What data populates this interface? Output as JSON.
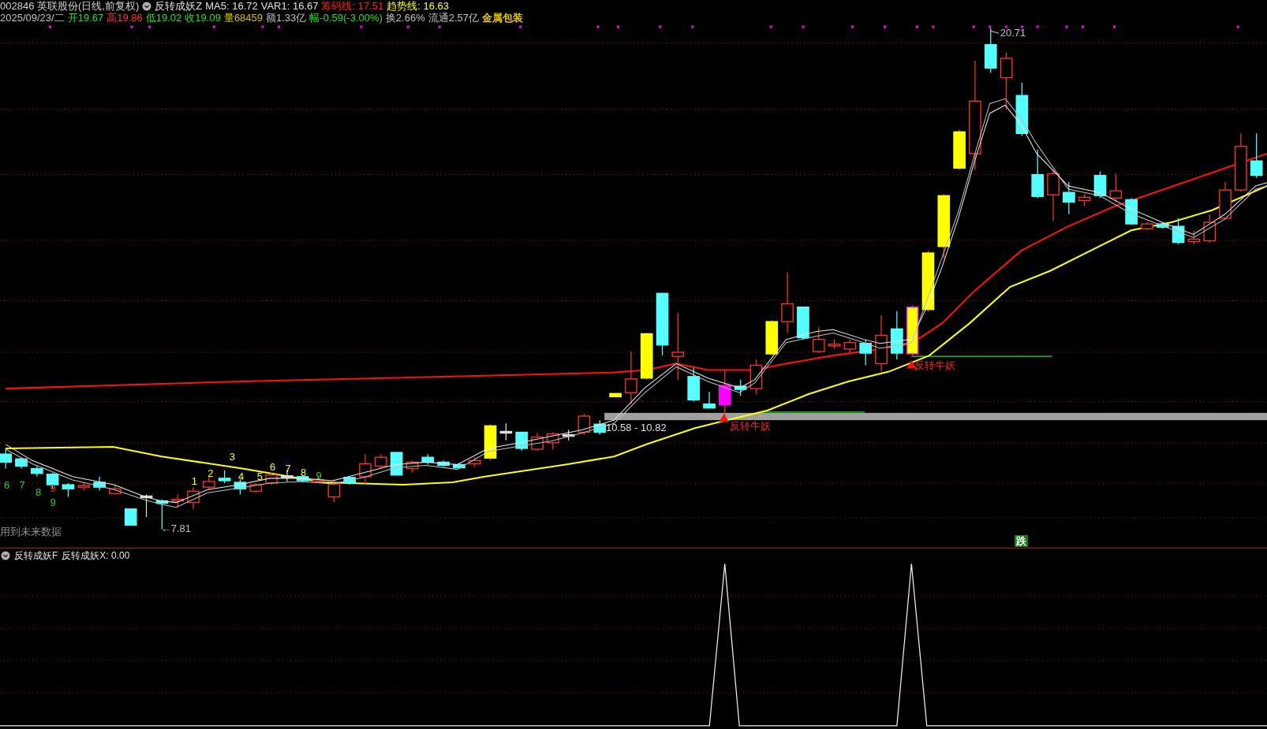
{
  "header": {
    "title": "002846 英联股份(日线,前复权)",
    "line1": [
      {
        "text": "反转成妖Z",
        "color": "#e0e0e0"
      },
      {
        "text": "MA5: 16.72",
        "color": "#e0e0e0"
      },
      {
        "text": "VAR1: 16.67",
        "color": "#e0e0e0"
      },
      {
        "text": "筹码线: 17.51",
        "color": "#ff2020"
      },
      {
        "text": "趋势线: 16.63",
        "color": "#ffff00"
      }
    ],
    "line2": [
      {
        "text": "2025/09/23/二",
        "color": "#c0c0c0"
      },
      {
        "text": "开19.67",
        "color": "#20e020"
      },
      {
        "text": "高19.86",
        "color": "#ff3030"
      },
      {
        "text": "低19.02",
        "color": "#20e020"
      },
      {
        "text": "收19.09",
        "color": "#20e020"
      },
      {
        "text": "量68459",
        "color": "#d4c000"
      },
      {
        "text": "额1.33亿",
        "color": "#c0c0c0"
      },
      {
        "text": "幅-0.59(-3.00%)",
        "color": "#20e020"
      },
      {
        "text": "换2.66%",
        "color": "#c0c0c0"
      },
      {
        "text": "流通2.57亿",
        "color": "#c0c0c0"
      },
      {
        "text": "金属包装",
        "color": "#e0c000",
        "kind": "sector"
      }
    ]
  },
  "main_chart": {
    "labels": [
      {
        "text": "6",
        "color": "#20d020",
        "kind": "plain"
      },
      {
        "text": "7",
        "color": "#20d020",
        "kind": "plain"
      },
      {
        "text": "8",
        "color": "#20d020",
        "kind": "plain"
      },
      {
        "text": "9",
        "color": "#ff2020",
        "kind": "plain"
      },
      {
        "text": "9",
        "color": "#20d020",
        "kind": "plain"
      },
      {
        "text": "1",
        "color": "#ffff00",
        "kind": "plain"
      },
      {
        "text": "2",
        "color": "#ffff00",
        "kind": "plain"
      },
      {
        "text": "3",
        "color": "#ffff00",
        "kind": "plain"
      },
      {
        "text": "4",
        "color": "#ffff00",
        "kind": "plain"
      },
      {
        "text": "5",
        "color": "#ffff00",
        "kind": "plain"
      },
      {
        "text": "6",
        "color": "#ffff00",
        "kind": "plain"
      },
      {
        "text": "7",
        "color": "#ffff00",
        "kind": "plain"
      },
      {
        "text": "8",
        "color": "#ffff00",
        "kind": "plain"
      },
      {
        "text": "9",
        "color": "#20d020",
        "kind": "plain"
      },
      {
        "text": "←7.81",
        "color": "#c0c0c0",
        "kind": "plain"
      },
      {
        "text": "20.71",
        "color": "#c0c0c0",
        "kind": "plain"
      },
      {
        "text": "10.58 - 10.82",
        "color": "#e0e0e0",
        "kind": "plain"
      },
      {
        "text": "反转牛妖",
        "color": "#ff2020",
        "kind": "plain"
      },
      {
        "text": "反转牛妖",
        "color": "#ff2020",
        "kind": "plain"
      },
      {
        "text": "用到未来数据",
        "color": "#909090",
        "kind": "plain"
      },
      {
        "text": "跌",
        "color": "#108010",
        "kind": "badge"
      }
    ]
  },
  "indicator": {
    "name": "反转成妖F",
    "readout": "反转成妖X: 0.00"
  }
}
